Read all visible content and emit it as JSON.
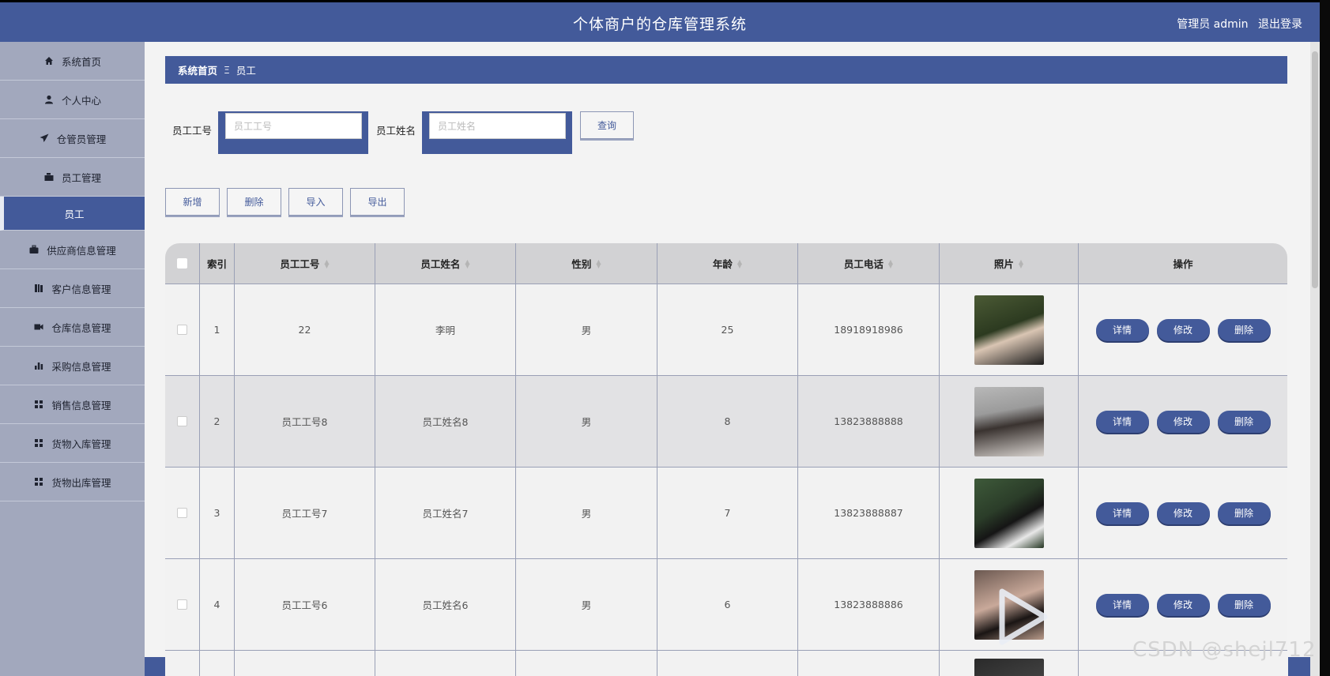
{
  "header": {
    "title": "个体商户的仓库管理系统",
    "user_label": "管理员 admin",
    "logout": "退出登录"
  },
  "sidebar": {
    "items": [
      {
        "label": "系统首页",
        "icon": "home-icon"
      },
      {
        "label": "个人中心",
        "icon": "user-icon"
      },
      {
        "label": "仓管员管理",
        "icon": "send-icon"
      },
      {
        "label": "员工管理",
        "icon": "briefcase-icon"
      },
      {
        "label": "员工",
        "icon": "",
        "active": true
      },
      {
        "label": "供应商信息管理",
        "icon": "suitcase-icon"
      },
      {
        "label": "客户信息管理",
        "icon": "book-icon"
      },
      {
        "label": "仓库信息管理",
        "icon": "video-icon"
      },
      {
        "label": "采购信息管理",
        "icon": "bar-chart-icon"
      },
      {
        "label": "销售信息管理",
        "icon": "grid-icon"
      },
      {
        "label": "货物入库管理",
        "icon": "grid-icon"
      },
      {
        "label": "货物出库管理",
        "icon": "grid-icon"
      }
    ]
  },
  "breadcrumb": {
    "home": "系统首页",
    "separator": "Ξ",
    "current": "员工"
  },
  "search": {
    "field1_label": "员工工号",
    "field1_placeholder": "员工工号",
    "field2_label": "员工姓名",
    "field2_placeholder": "员工姓名",
    "query_button": "查询"
  },
  "actions": {
    "add": "新增",
    "delete": "删除",
    "import": "导入",
    "export": "导出"
  },
  "table": {
    "columns": [
      "索引",
      "员工工号",
      "员工姓名",
      "性别",
      "年龄",
      "员工电话",
      "照片",
      "操作"
    ],
    "row_buttons": {
      "detail": "详情",
      "edit": "修改",
      "delete": "删除"
    },
    "rows": [
      {
        "index": "1",
        "emp_no": "22",
        "name": "李明",
        "gender": "男",
        "age": "25",
        "phone": "18918918986"
      },
      {
        "index": "2",
        "emp_no": "员工工号8",
        "name": "员工姓名8",
        "gender": "男",
        "age": "8",
        "phone": "13823888888"
      },
      {
        "index": "3",
        "emp_no": "员工工号7",
        "name": "员工姓名7",
        "gender": "男",
        "age": "7",
        "phone": "13823888887"
      },
      {
        "index": "4",
        "emp_no": "员工工号6",
        "name": "员工姓名6",
        "gender": "男",
        "age": "6",
        "phone": "13823888886"
      }
    ]
  },
  "watermark": "CSDN @shejl712",
  "colors": {
    "primary": "#435a9a",
    "sidebar": "#a2a8bd",
    "background": "#f3f3f3"
  }
}
